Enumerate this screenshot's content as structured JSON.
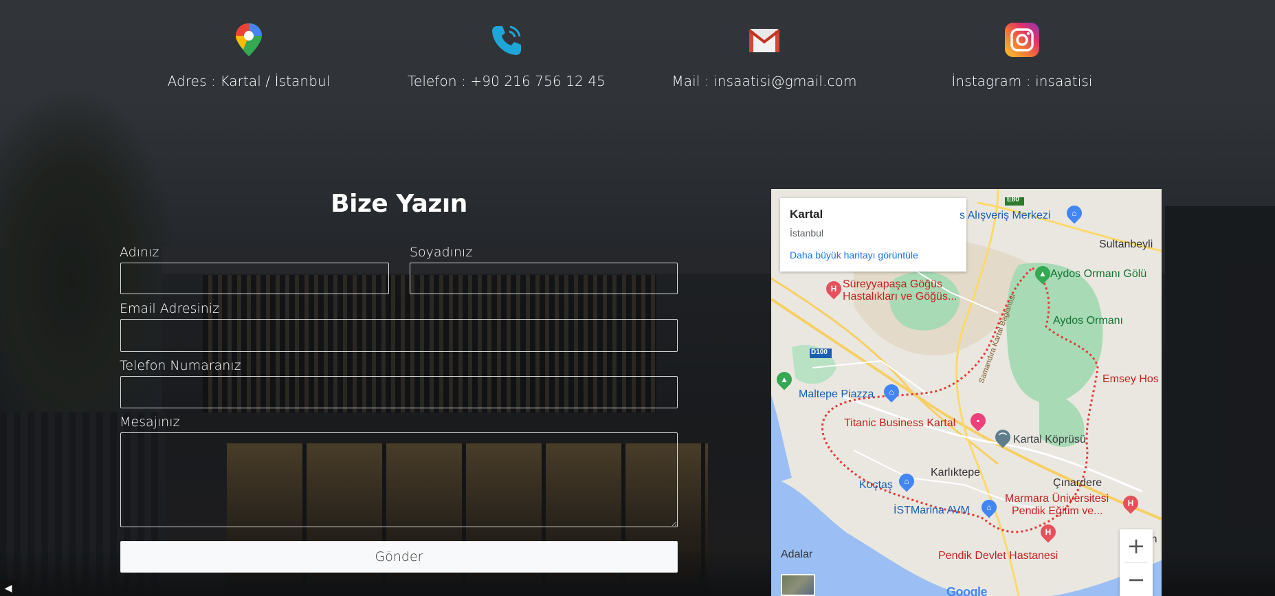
{
  "contact": {
    "address": "Adres : Kartal / İstanbul",
    "phone": "Telefon : +90 216 756 12 45",
    "mail": "Mail : insaatisi@gmail.com",
    "instagram": "İnstagram : insaatisi",
    "icons": [
      "map-pin-icon",
      "phone-icon",
      "gmail-icon",
      "instagram-icon"
    ]
  },
  "form": {
    "title": "Bize Yazın",
    "first_name_label": "Adınız",
    "last_name_label": "Soyadınız",
    "email_label": "Email Adresiniz",
    "phone_label": "Telefon Numaranız",
    "message_label": "Mesajınız",
    "first_name_value": "",
    "last_name_value": "",
    "email_value": "",
    "phone_value": "",
    "message_value": "",
    "submit_label": "Gönder"
  },
  "map": {
    "place": "Kartal",
    "region": "İstanbul",
    "link": "Daha büyük haritayı görüntüle",
    "labels": {
      "alisveris": "s Alışveriş Merkezi",
      "sultanbeyli": "Sultanbeyli",
      "aydos_golu": "Aydos Ormanı Gölü",
      "suren_1": "Süreyyapaşa Göğüs",
      "suren_2": "Hastalıkları ve Göğüs...",
      "aydos_ormani": "Aydos Ormanı",
      "samandira": "Samandıra Kartal Bağlantısı",
      "d100": "D100",
      "e80": "E80",
      "emsey": "Emsey Hos",
      "maltepe_piazza": "Maltepe Piazza",
      "titanic": "Titanic Business Kartal",
      "kartal_koprusu": "Kartal Köprüsü",
      "karliktepe": "Karlıktepe",
      "cinardere": "Çınardere",
      "koctas": "Koçtaş",
      "marmara_1": "Marmara Üniversitesi",
      "marmara_2": "Pendik Eğitim ve...",
      "istmarina": "İSTMarina AVM",
      "pen": "Pen",
      "adalar": "Adalar",
      "pendik_devlet": "Pendik Devlet Hastanesi",
      "google": "Google"
    },
    "zoom_in": "+",
    "zoom_out": "−"
  },
  "colors": {
    "accent_blue": "#1a73e8",
    "map_water": "#9bbff4",
    "map_park": "#a8dab5",
    "boundary": "#e53935"
  }
}
